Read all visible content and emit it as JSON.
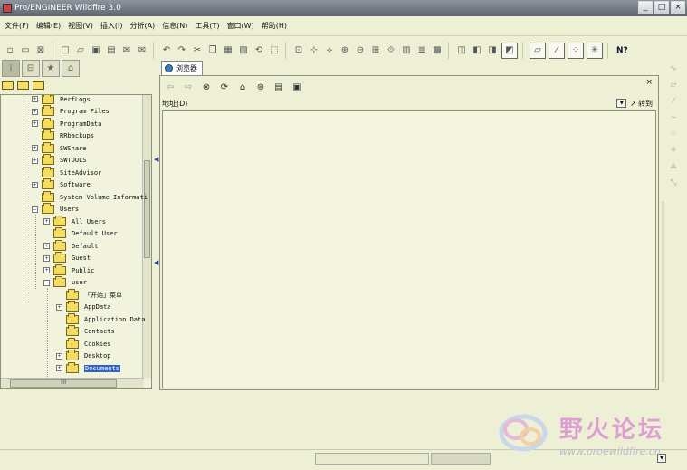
{
  "window": {
    "title": "Pro/ENGINEER Wildfire 3.0",
    "controls": [
      "_",
      "□",
      "×"
    ]
  },
  "menubar": [
    "文件(F)",
    "编辑(E)",
    "视图(V)",
    "插入(I)",
    "分析(A)",
    "信息(N)",
    "工具(T)",
    "窗口(W)",
    "帮助(H)"
  ],
  "toolbar": {
    "help_label": "N?"
  },
  "navigator": {
    "tabs": [
      "model-tree",
      "folder-browser",
      "favorites",
      "connections"
    ],
    "tree": [
      {
        "label": "PerfLogs",
        "level": 1,
        "expandable": true
      },
      {
        "label": "Program Files",
        "level": 1,
        "expandable": true
      },
      {
        "label": "ProgramData",
        "level": 1,
        "expandable": true
      },
      {
        "label": "RRbackups",
        "level": 1,
        "expandable": false
      },
      {
        "label": "SWShare",
        "level": 1,
        "expandable": true
      },
      {
        "label": "SWTOOLS",
        "level": 1,
        "expandable": true
      },
      {
        "label": "SiteAdvisor",
        "level": 1,
        "expandable": false
      },
      {
        "label": "Software",
        "level": 1,
        "expandable": true
      },
      {
        "label": "System Volume Informati",
        "level": 1,
        "expandable": false
      },
      {
        "label": "Users",
        "level": 1,
        "expandable": true,
        "expanded": true
      },
      {
        "label": "All Users",
        "level": 2,
        "expandable": true
      },
      {
        "label": "Default User",
        "level": 2,
        "expandable": false
      },
      {
        "label": "Default",
        "level": 2,
        "expandable": true
      },
      {
        "label": "Guest",
        "level": 2,
        "expandable": true
      },
      {
        "label": "Public",
        "level": 2,
        "expandable": true
      },
      {
        "label": "user",
        "level": 2,
        "expandable": true,
        "expanded": true
      },
      {
        "label": "「开始」菜单",
        "level": 3,
        "expandable": false
      },
      {
        "label": "AppData",
        "level": 3,
        "expandable": true
      },
      {
        "label": "Application Data",
        "level": 3,
        "expandable": false
      },
      {
        "label": "Contacts",
        "level": 3,
        "expandable": false
      },
      {
        "label": "Cookies",
        "level": 3,
        "expandable": false
      },
      {
        "label": "Desktop",
        "level": 3,
        "expandable": true
      },
      {
        "label": "Documents",
        "level": 3,
        "expandable": true,
        "selected": true
      }
    ],
    "hscroll_text": "III"
  },
  "browser": {
    "tab_label": "浏览器",
    "address_label": "地址(D)",
    "address_value": "",
    "goto_label": "转到"
  },
  "watermark": {
    "main": "野火论坛",
    "sub": "www.proewildfire.cn"
  },
  "colors": {
    "background": "#eef0d6",
    "selection": "#3163c6",
    "folder": "#f4dc62",
    "watermark": "#db9fd0"
  }
}
